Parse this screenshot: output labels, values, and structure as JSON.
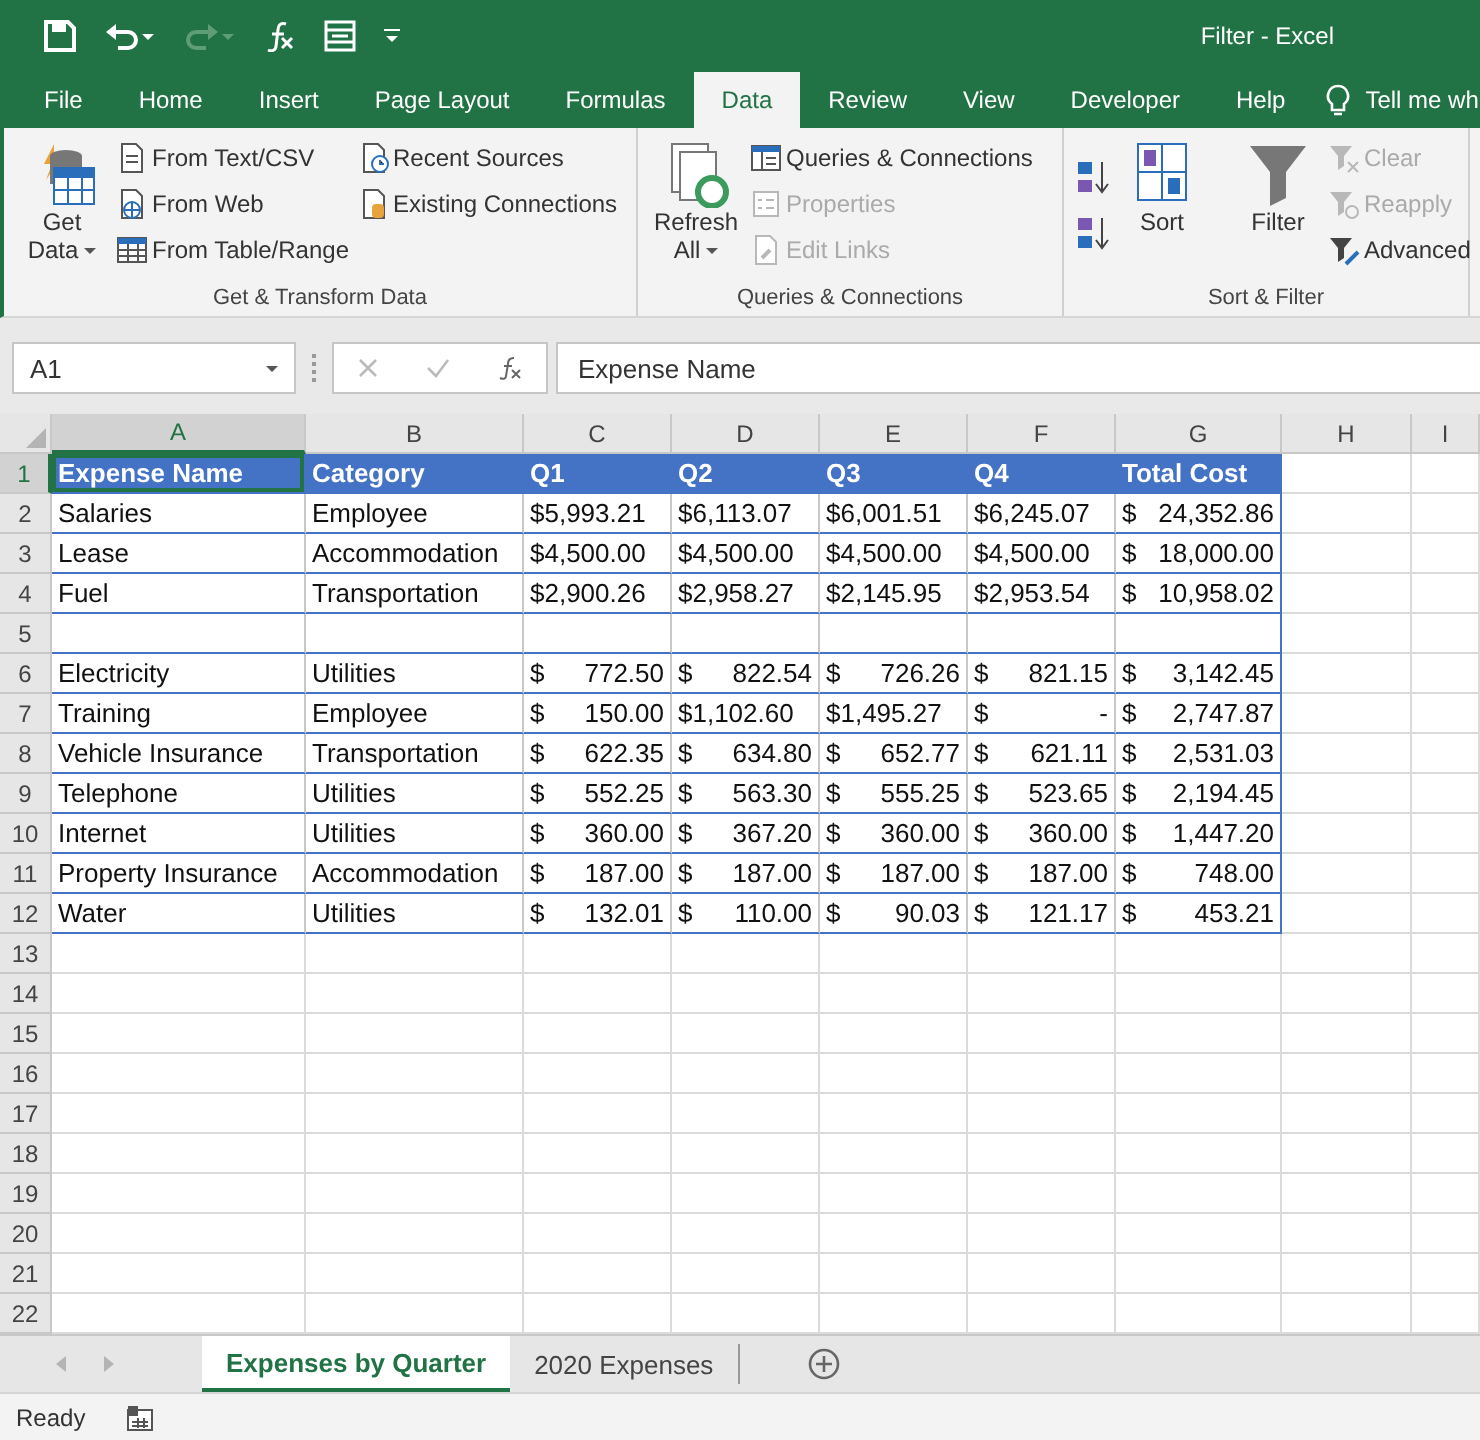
{
  "window": {
    "title": "Filter - Excel"
  },
  "quick_access": {
    "undo": {
      "disabled": false
    },
    "redo": {
      "disabled": true
    }
  },
  "ribbon_tabs": [
    {
      "label": "File",
      "selected": false
    },
    {
      "label": "Home",
      "selected": false
    },
    {
      "label": "Insert",
      "selected": false
    },
    {
      "label": "Page Layout",
      "selected": false
    },
    {
      "label": "Formulas",
      "selected": false
    },
    {
      "label": "Data",
      "selected": true
    },
    {
      "label": "Review",
      "selected": false
    },
    {
      "label": "View",
      "selected": false
    },
    {
      "label": "Developer",
      "selected": false
    },
    {
      "label": "Help",
      "selected": false
    }
  ],
  "tell_me": {
    "text": "Tell me wh"
  },
  "ribbon_groups": [
    {
      "label": "Get & Transform Data",
      "controls": [
        {
          "kind": "large",
          "label": "Get Data",
          "dropdown": true,
          "disabled": false
        },
        {
          "kind": "stack",
          "items": [
            {
              "label": "From Text/CSV",
              "disabled": false
            },
            {
              "label": "From Web",
              "disabled": false
            },
            {
              "label": "From Table/Range",
              "disabled": false
            }
          ]
        },
        {
          "kind": "stack",
          "items": [
            {
              "label": "Recent Sources",
              "disabled": false
            },
            {
              "label": "Existing Connections",
              "disabled": false
            }
          ]
        }
      ]
    },
    {
      "label": "Queries & Connections",
      "controls": [
        {
          "kind": "large",
          "label": "Refresh All",
          "dropdown": true,
          "disabled": false
        },
        {
          "kind": "stack",
          "items": [
            {
              "label": "Queries & Connections",
              "disabled": false
            },
            {
              "label": "Properties",
              "disabled": true
            },
            {
              "label": "Edit Links",
              "disabled": true
            }
          ]
        }
      ]
    },
    {
      "label": "Sort & Filter",
      "controls": [
        {
          "kind": "sort_icons"
        },
        {
          "kind": "large",
          "label": "Sort",
          "dropdown": false,
          "disabled": false
        },
        {
          "kind": "large",
          "label": "Filter",
          "dropdown": false,
          "disabled": false
        },
        {
          "kind": "stack",
          "items": [
            {
              "label": "Clear",
              "disabled": true
            },
            {
              "label": "Reapply",
              "disabled": true
            },
            {
              "label": "Advanced",
              "disabled": false
            }
          ]
        }
      ]
    }
  ],
  "formula_bar": {
    "name_box": "A1",
    "formula": "Expense Name"
  },
  "sheet": {
    "columns": [
      {
        "label": "A",
        "selected": true
      },
      {
        "label": "B",
        "selected": false
      },
      {
        "label": "C",
        "selected": false
      },
      {
        "label": "D",
        "selected": false
      },
      {
        "label": "E",
        "selected": false
      },
      {
        "label": "F",
        "selected": false
      },
      {
        "label": "G",
        "selected": false
      },
      {
        "label": "H",
        "selected": false
      },
      {
        "label": "I",
        "selected": false
      }
    ],
    "rows": [
      {
        "number": "1",
        "selected": true,
        "kind": "header",
        "cells": [
          "Expense Name",
          "Category",
          "Q1",
          "Q2",
          "Q3",
          "Q4",
          "Total Cost"
        ]
      },
      {
        "number": "2",
        "selected": false,
        "kind": "body",
        "cells": [
          "Salaries",
          "Employee",
          "$5,993.21",
          "$6,113.07",
          "$6,001.51",
          "$6,245.07",
          "$ 24,352.86"
        ]
      },
      {
        "number": "3",
        "selected": false,
        "kind": "body",
        "cells": [
          "Lease",
          "Accommodation",
          "$4,500.00",
          "$4,500.00",
          "$4,500.00",
          "$4,500.00",
          "$ 18,000.00"
        ]
      },
      {
        "number": "4",
        "selected": false,
        "kind": "body",
        "cells": [
          "Fuel",
          "Transportation",
          "$2,900.26",
          "$2,958.27",
          "$2,145.95",
          "$2,953.54",
          "$ 10,958.02"
        ]
      },
      {
        "number": "5",
        "selected": false,
        "kind": "body"
      },
      {
        "number": "6",
        "selected": false,
        "kind": "body",
        "cells": [
          "Electricity",
          "Utilities",
          "$ 772.50",
          "$ 822.54",
          "$ 726.26",
          "$ 821.15",
          "$ 3,142.45"
        ]
      },
      {
        "number": "7",
        "selected": false,
        "kind": "body",
        "cells": [
          "Training",
          "Employee",
          "$ 150.00",
          "$1,102.60",
          "$1,495.27",
          "$ -",
          "$ 2,747.87"
        ]
      },
      {
        "number": "8",
        "selected": false,
        "kind": "body",
        "cells": [
          "Vehicle Insurance",
          "Transportation",
          "$ 622.35",
          "$ 634.80",
          "$ 652.77",
          "$ 621.11",
          "$ 2,531.03"
        ]
      },
      {
        "number": "9",
        "selected": false,
        "kind": "body",
        "cells": [
          "Telephone",
          "Utilities",
          "$ 552.25",
          "$ 563.30",
          "$ 555.25",
          "$ 523.65",
          "$ 2,194.45"
        ]
      },
      {
        "number": "10",
        "selected": false,
        "kind": "body",
        "cells": [
          "Internet",
          "Utilities",
          "$ 360.00",
          "$ 367.20",
          "$ 360.00",
          "$ 360.00",
          "$ 1,447.20"
        ]
      },
      {
        "number": "11",
        "selected": false,
        "kind": "body",
        "cells": [
          "Property Insurance",
          "Accommodation",
          "$ 187.00",
          "$ 187.00",
          "$ 187.00",
          "$ 187.00",
          "$ 748.00"
        ]
      },
      {
        "number": "12",
        "selected": false,
        "kind": "body",
        "cells": [
          "Water",
          "Utilities",
          "$ 132.01",
          "$ 110.00",
          "$ 90.03",
          "$ 121.17",
          "$ 453.21"
        ]
      },
      {
        "number": "13",
        "selected": false,
        "kind": "blank"
      },
      {
        "number": "14",
        "selected": false,
        "kind": "blank"
      },
      {
        "number": "15",
        "selected": false,
        "kind": "blank"
      },
      {
        "number": "16",
        "selected": false,
        "kind": "blank"
      },
      {
        "number": "17",
        "selected": false,
        "kind": "blank"
      },
      {
        "number": "18",
        "selected": false,
        "kind": "blank"
      },
      {
        "number": "19",
        "selected": false,
        "kind": "blank"
      },
      {
        "number": "20",
        "selected": false,
        "kind": "blank"
      },
      {
        "number": "21",
        "selected": false,
        "kind": "blank"
      },
      {
        "number": "22",
        "selected": false,
        "kind": "blank"
      }
    ]
  },
  "sheet_tabs": [
    {
      "label": "Expenses by Quarter",
      "selected": true
    },
    {
      "label": "2020 Expenses",
      "selected": false
    }
  ],
  "status_bar": {
    "text": "Ready"
  }
}
